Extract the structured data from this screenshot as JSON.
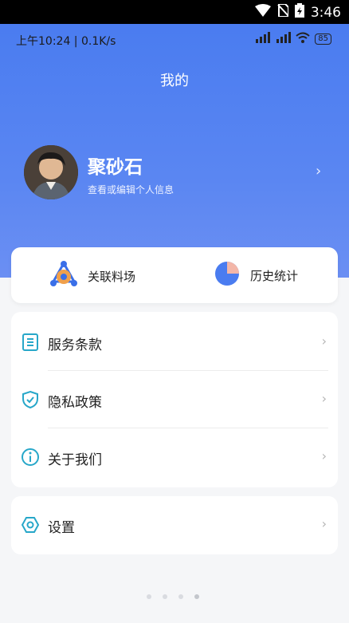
{
  "system_bar": {
    "time": "3:46"
  },
  "status_line": {
    "left": "上午10:24 | 0.1K/s",
    "battery": "85"
  },
  "header": {
    "title": "我的"
  },
  "profile": {
    "name": "聚砂石",
    "subtitle": "查看或编辑个人信息"
  },
  "quick_actions": [
    {
      "label": "关联料场",
      "icon": "linked-yard-icon"
    },
    {
      "label": "历史统计",
      "icon": "pie-chart-icon"
    }
  ],
  "menu": [
    {
      "label": "服务条款",
      "icon": "document-icon"
    },
    {
      "label": "隐私政策",
      "icon": "shield-check-icon"
    },
    {
      "label": "关于我们",
      "icon": "info-icon"
    }
  ],
  "settings": {
    "label": "设置",
    "icon": "hexagon-settings-icon"
  },
  "colors": {
    "accent": "#4a7cf0",
    "icon_teal": "#27a7c9"
  }
}
